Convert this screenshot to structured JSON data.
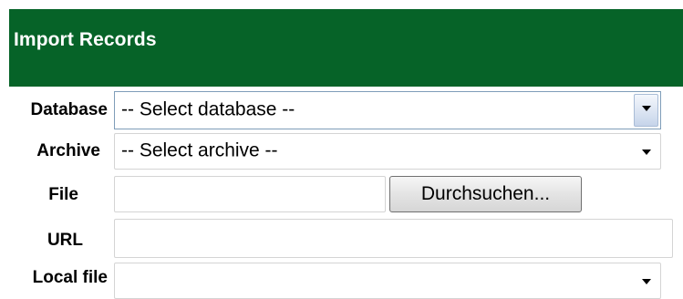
{
  "header": {
    "title": "Import Records",
    "background_color": "#066328"
  },
  "form": {
    "database": {
      "label": "Database",
      "selected": "-- Select database --"
    },
    "archive": {
      "label": "Archive",
      "selected": "-- Select archive --"
    },
    "file": {
      "label": "File",
      "value": "",
      "browse_label": "Durchsuchen..."
    },
    "url": {
      "label": "URL",
      "value": ""
    },
    "local_file": {
      "label": "Local file",
      "selected": ""
    }
  },
  "icons": {
    "dropdown": "chevron-down-icon"
  }
}
